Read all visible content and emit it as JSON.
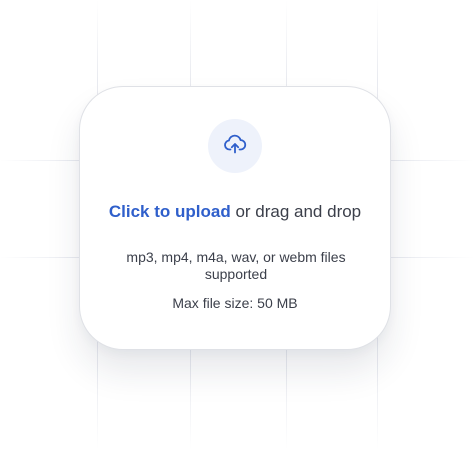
{
  "dropzone": {
    "upload_link_label": "Click to upload",
    "drag_text": "or drag and drop",
    "supported_formats": "mp3, mp4, m4a, wav, or webm files supported",
    "max_size": "Max file size: 50 MB",
    "icon": "cloud-upload-icon"
  },
  "colors": {
    "accent": "#2f5fcb",
    "text": "#3b3f4a",
    "icon_bg": "#eef2fb",
    "border": "#dfe1e6"
  }
}
